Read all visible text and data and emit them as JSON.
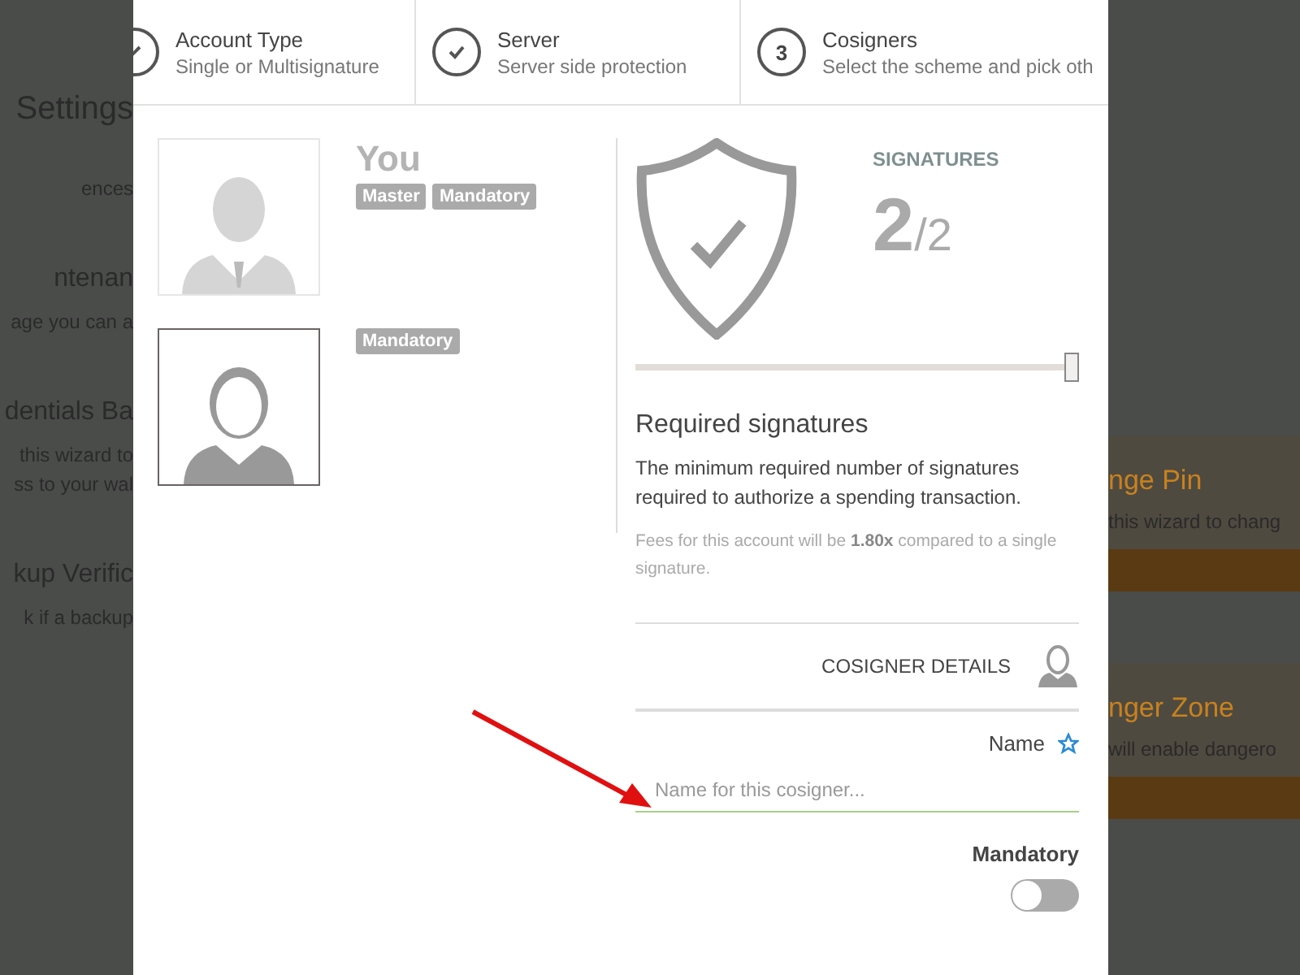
{
  "background_page": {
    "left_texts": [
      {
        "kind": "title",
        "text": "Settings"
      },
      {
        "kind": "tab",
        "text": "ences"
      },
      {
        "kind": "heading",
        "text": "ntenan"
      },
      {
        "kind": "body",
        "text": "age you can a"
      },
      {
        "kind": "heading",
        "text": "dentials Ba"
      },
      {
        "kind": "body",
        "text": "this wizard to"
      },
      {
        "kind": "body",
        "text": "ss to your wal"
      },
      {
        "kind": "heading",
        "text": "kup Verific"
      },
      {
        "kind": "body",
        "text": "k if a backup"
      }
    ],
    "right_cards": [
      {
        "title": "nge Pin",
        "text": "this wizard to chang"
      },
      {
        "title": "nger Zone",
        "text": "will enable dangero"
      }
    ]
  },
  "steps": [
    {
      "kind": "edit",
      "title": "Account Type",
      "subtitle": "Single or Multisignature"
    },
    {
      "kind": "done",
      "title": "Server",
      "subtitle": "Server side protection"
    },
    {
      "kind": "number",
      "number": "3",
      "title": "Cosigners",
      "subtitle": "Select the scheme and pick oth"
    }
  ],
  "cosigners": [
    {
      "kind": "suit",
      "name": "You",
      "selected": false,
      "tags": [
        "Master",
        "Mandatory"
      ]
    },
    {
      "kind": "plain",
      "selected": true,
      "tags": [
        "Mandatory"
      ]
    }
  ],
  "signatures": {
    "label": "SIGNATURES",
    "count": "2",
    "total": "/2"
  },
  "slider": {
    "level": 1
  },
  "required": {
    "title": "Required signatures",
    "description": "The minimum required number of signatures required to authorize a spending transaction.",
    "fees": "Fees for this account will be **1.80x** compared to a single signature."
  },
  "details": {
    "title": "COSIGNER DETAILS",
    "name_label": "Name",
    "name_placeholder": "Name for this cosigner...",
    "mandatory_label": "Mandatory",
    "mandatory_on": false
  }
}
